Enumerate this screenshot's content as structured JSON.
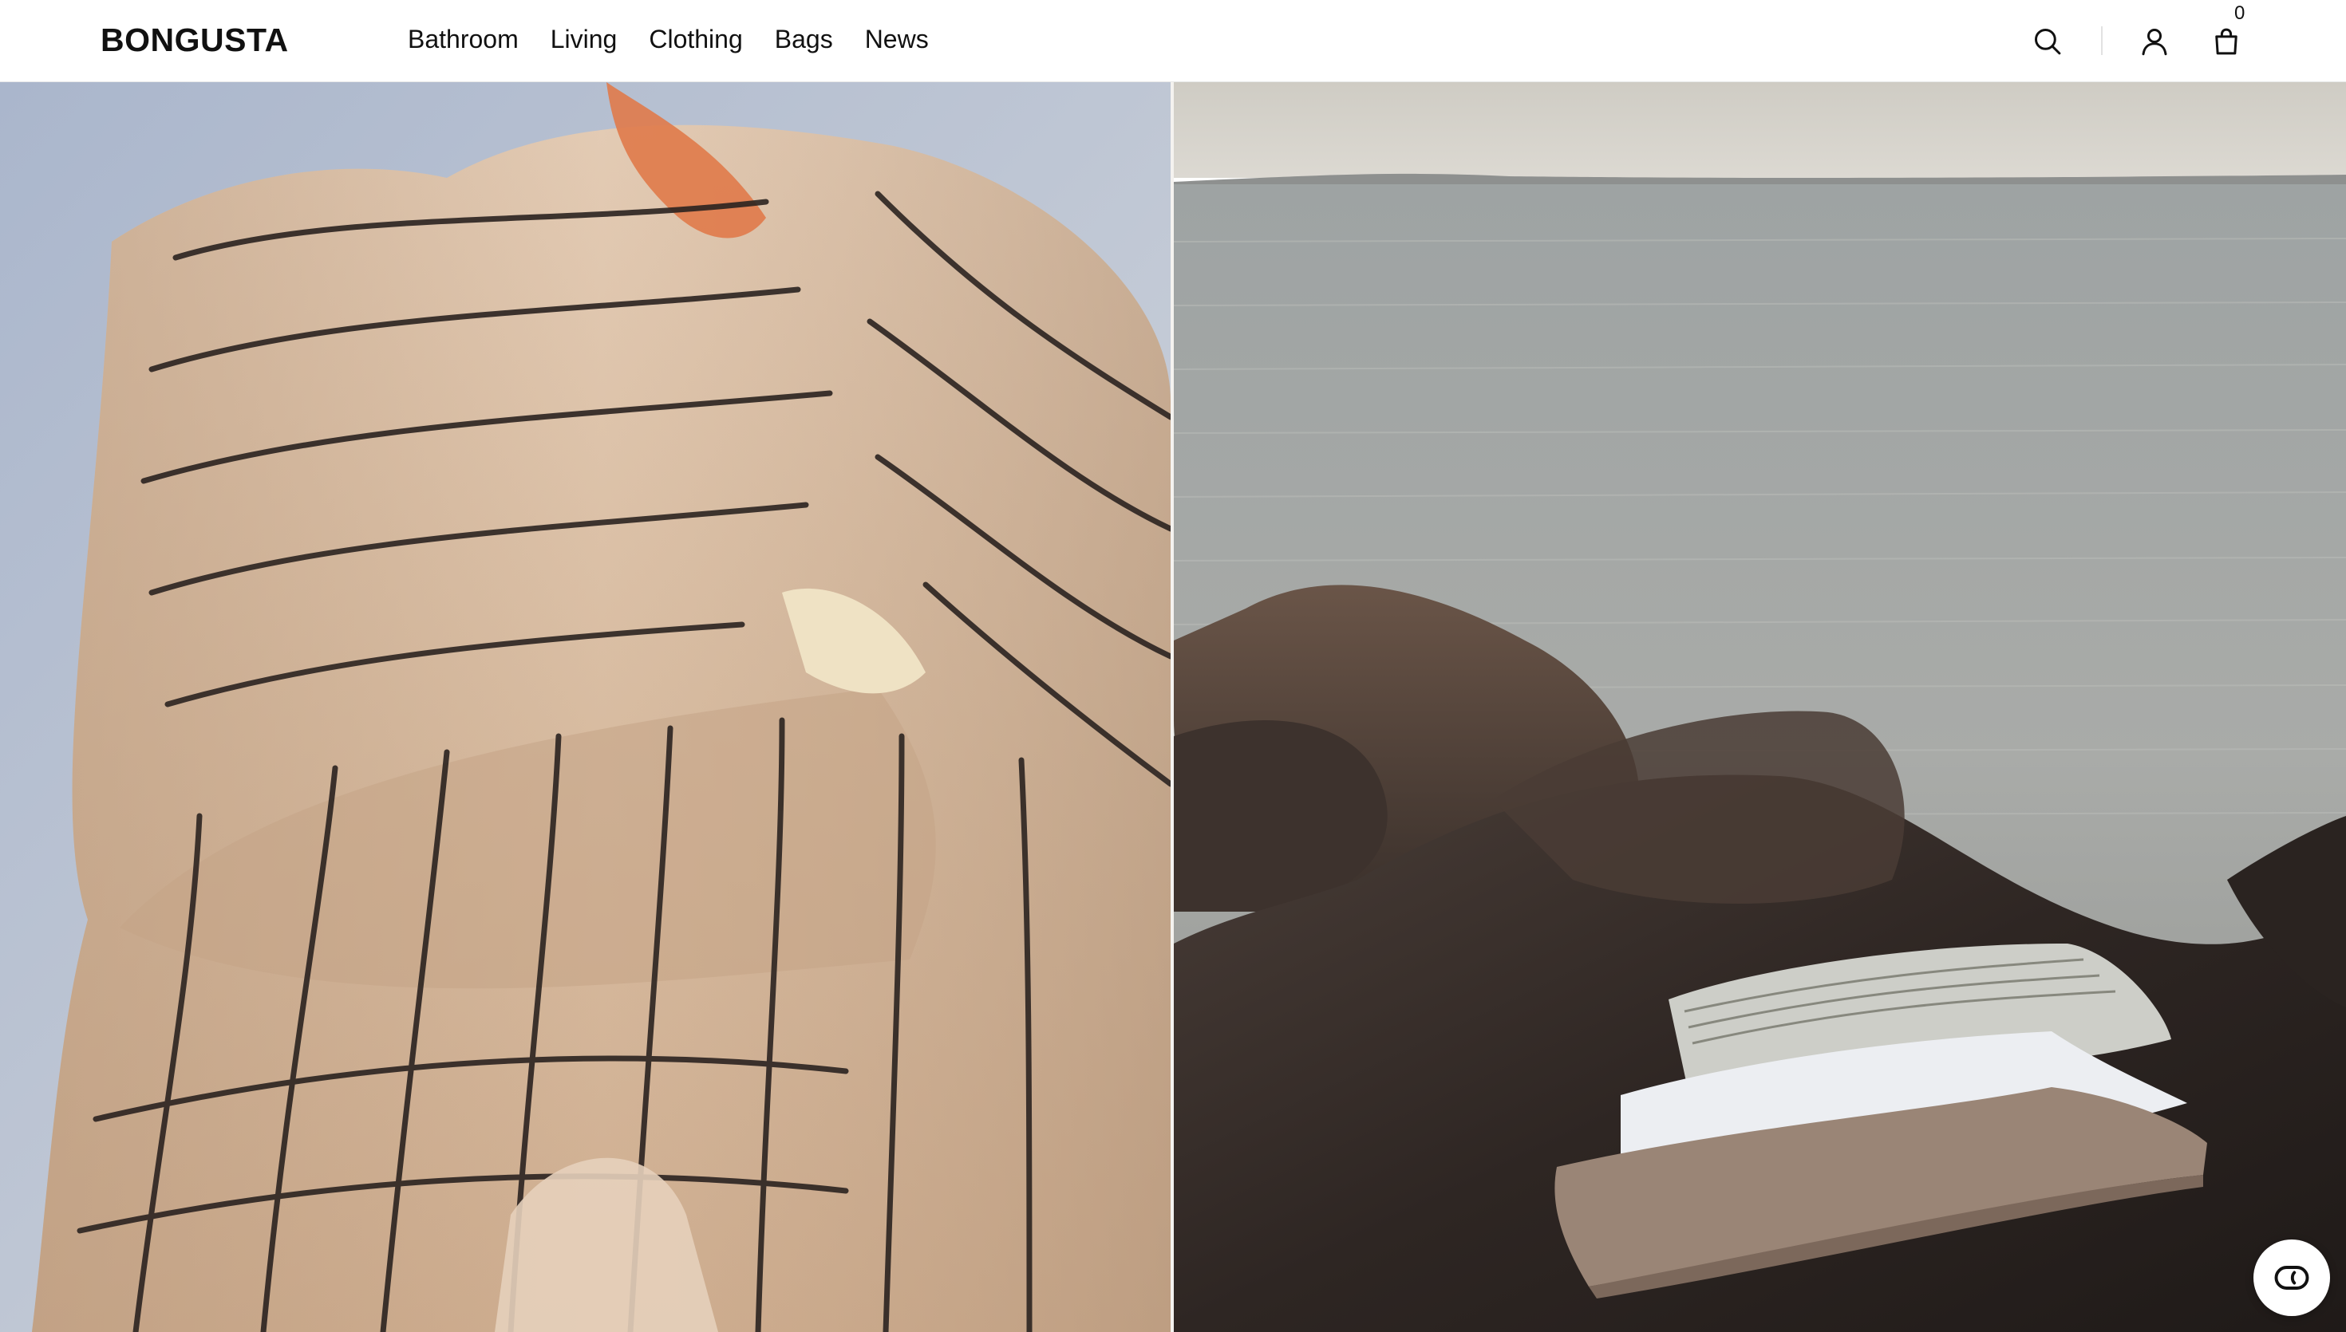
{
  "brand": {
    "logo_text": "BONGUSTA"
  },
  "nav": {
    "items": [
      {
        "label": "Bathroom"
      },
      {
        "label": "Living"
      },
      {
        "label": "Clothing"
      },
      {
        "label": "Bags"
      },
      {
        "label": "News"
      }
    ]
  },
  "header_actions": {
    "search_icon": "search-icon",
    "account_icon": "user-icon",
    "bag_icon": "shopping-bag-icon",
    "cart_count": "0"
  },
  "hero": {
    "left_image": "striped-bathrobe-photo",
    "right_image": "blankets-on-rocks-by-sea-photo"
  },
  "chat": {
    "icon": "chat-widget-icon"
  },
  "colors": {
    "text": "#111111",
    "background": "#ffffff",
    "sky": "#b9c4d6",
    "robe": "#dcc2aa",
    "sea": "#a7a9a7",
    "rock": "#2b2522"
  }
}
